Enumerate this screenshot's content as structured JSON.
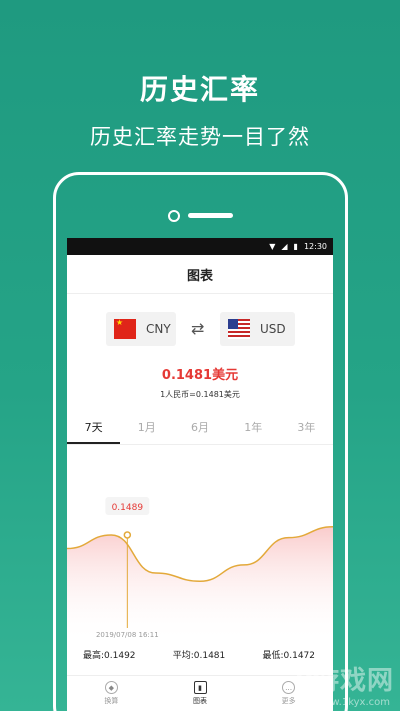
{
  "promo": {
    "title": "历史汇率",
    "subtitle": "历史汇率走势一目了然"
  },
  "statusbar": {
    "time": "12:30",
    "icons": [
      "wifi-icon",
      "signal-icon",
      "battery-icon"
    ]
  },
  "header": {
    "title": "图表"
  },
  "currency": {
    "from": {
      "code": "CNY",
      "flag": "china-flag-icon"
    },
    "to": {
      "code": "USD",
      "flag": "us-flag-icon"
    },
    "swap_icon": "swap-icon"
  },
  "rate": {
    "main": "0.1481美元",
    "sub": "1人民币=0.1481美元"
  },
  "tabs": [
    {
      "label": "7天",
      "active": true
    },
    {
      "label": "1月",
      "active": false
    },
    {
      "label": "6月",
      "active": false
    },
    {
      "label": "1年",
      "active": false
    },
    {
      "label": "3年",
      "active": false
    }
  ],
  "chart_data": {
    "type": "line",
    "series": [
      {
        "values": [
          0.1484,
          0.1489,
          0.1475,
          0.1472,
          0.1478,
          0.1488,
          0.1492
        ]
      }
    ],
    "tooltip": {
      "value": "0.1489",
      "date": "2019/07/08 16:11",
      "index": 1
    },
    "line_color": "#e3a93a",
    "fill_color": "#f9c6c6"
  },
  "stats": {
    "high": "最高:0.1492",
    "avg": "平均:0.1481",
    "low": "最低:0.1472"
  },
  "bottom_nav": [
    {
      "label": "换算",
      "icon": "convert-icon",
      "active": false
    },
    {
      "label": "图表",
      "icon": "chart-icon",
      "active": true
    },
    {
      "label": "更多",
      "icon": "more-icon",
      "active": false
    }
  ],
  "watermark": {
    "text": "k游戏网",
    "url": "www.1kyx.com"
  }
}
